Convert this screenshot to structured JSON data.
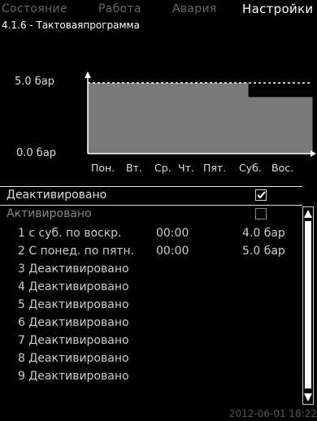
{
  "tabs": [
    "Состояние",
    "Работа",
    "Авария",
    "Настройки"
  ],
  "screen_title": "4.1.6 - Тактоваяпрограмма",
  "chart_data": {
    "type": "area",
    "categories": [
      "Пон.",
      "Вт.",
      "Ср.",
      "Чт.",
      "Пят.",
      "Суб.",
      "Вос."
    ],
    "values": [
      5.0,
      5.0,
      5.0,
      5.0,
      5.0,
      4.0,
      4.0
    ],
    "ylim": [
      0.0,
      5.0
    ],
    "y_tick_labels": [
      "5.0 бар",
      "0.0 бар"
    ],
    "max_line_dashed": true
  },
  "options": [
    {
      "label": "Деактивировано",
      "checked": true
    },
    {
      "label": "Активировано",
      "checked": false
    }
  ],
  "programs": [
    {
      "label": "1 с суб. по воскр.",
      "time": "00:00",
      "value": "4.0 бар"
    },
    {
      "label": "2 С понед. по пятн.",
      "time": "00:00",
      "value": "5.0 бар"
    },
    {
      "label": "3 Деактивировано",
      "time": "",
      "value": ""
    },
    {
      "label": "4 Деактивировано",
      "time": "",
      "value": ""
    },
    {
      "label": "5 Деактивировано",
      "time": "",
      "value": ""
    },
    {
      "label": "6 Деактивировано",
      "time": "",
      "value": ""
    },
    {
      "label": "7 Деактивировано",
      "time": "",
      "value": ""
    },
    {
      "label": "8 Деактивировано",
      "time": "",
      "value": ""
    },
    {
      "label": "9 Деактивировано",
      "time": "",
      "value": ""
    }
  ],
  "footer": "2012-06-01 18:22"
}
